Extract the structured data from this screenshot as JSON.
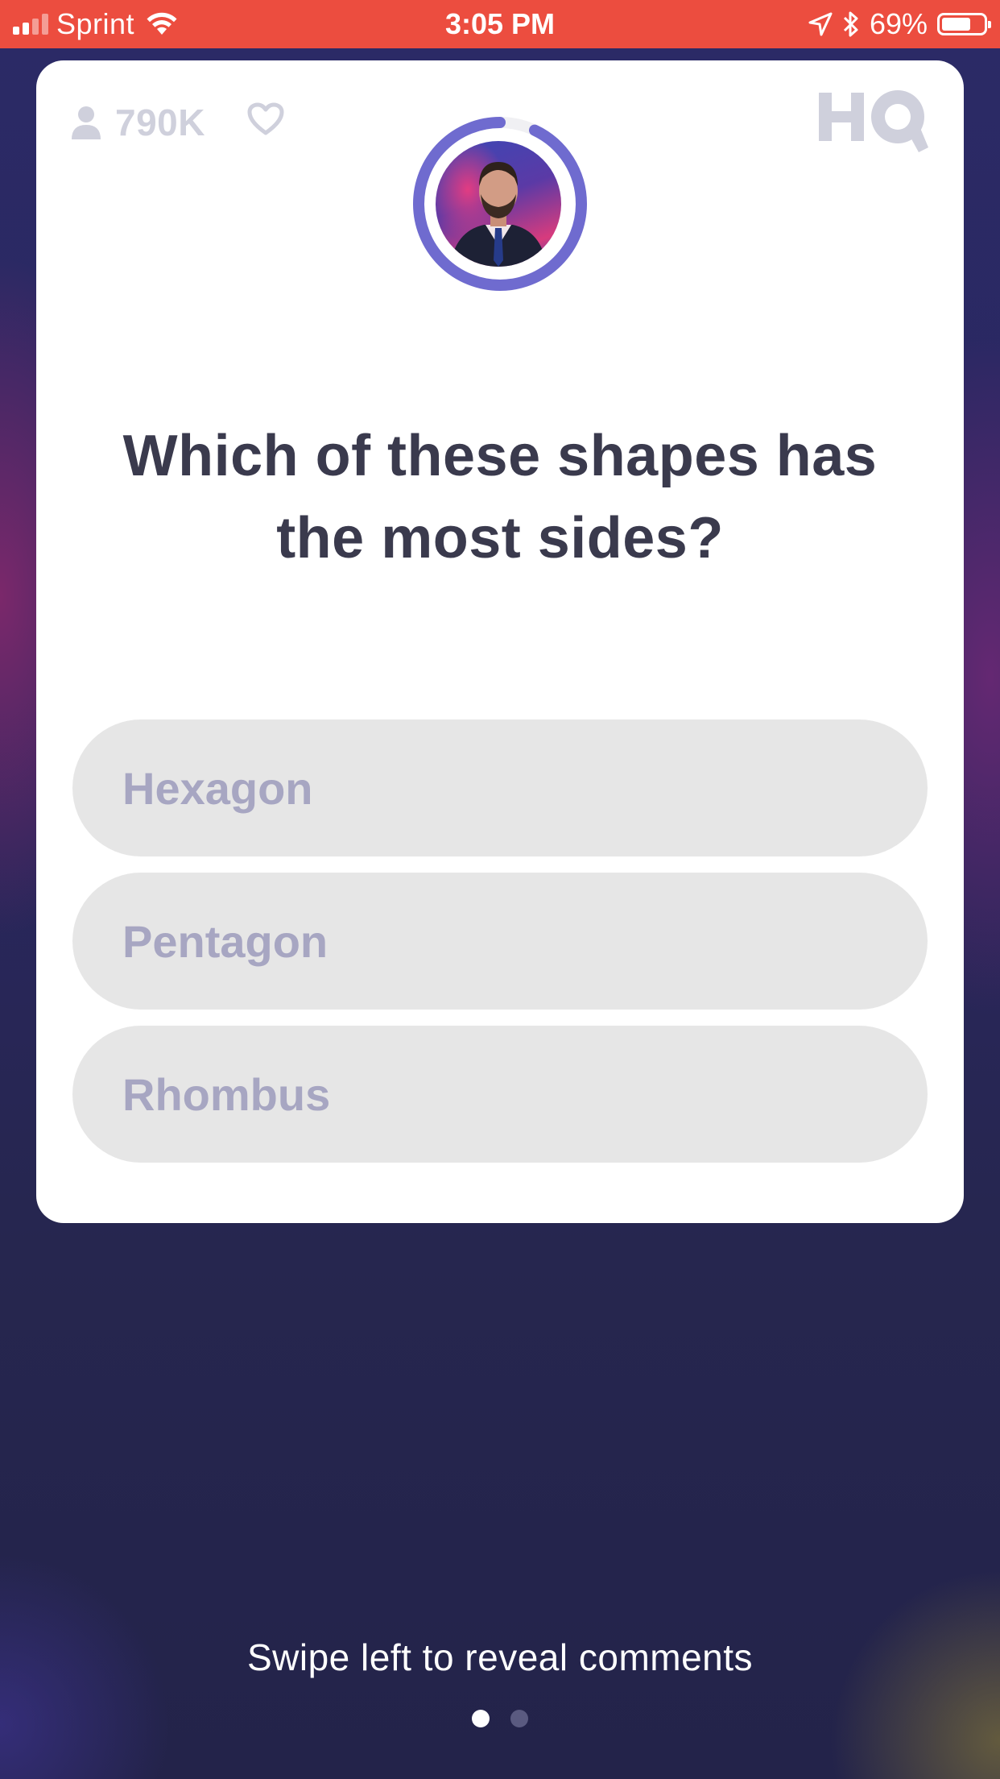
{
  "status_bar": {
    "carrier": "Sprint",
    "time": "3:05 PM",
    "battery_percent": "69%",
    "battery_level": 0.69,
    "signal_bars": 2,
    "icons": [
      "signal-icon",
      "wifi-icon",
      "location-arrow-icon",
      "bluetooth-icon",
      "battery-icon"
    ],
    "background_color": "#ec4d3f"
  },
  "game": {
    "viewer_count": "790K",
    "icons": [
      "person-icon",
      "heart-icon",
      "hq-logo",
      "countdown-ring"
    ],
    "timer_progress": 0.93,
    "accent_color": "#6f6bcf",
    "question": "Which of these shapes has the most sides?",
    "answers": [
      {
        "label": "Hexagon"
      },
      {
        "label": "Pentagon"
      },
      {
        "label": "Rhombus"
      }
    ]
  },
  "footer": {
    "hint": "Swipe left to reveal comments",
    "page_count": 2,
    "active_page": 1
  }
}
